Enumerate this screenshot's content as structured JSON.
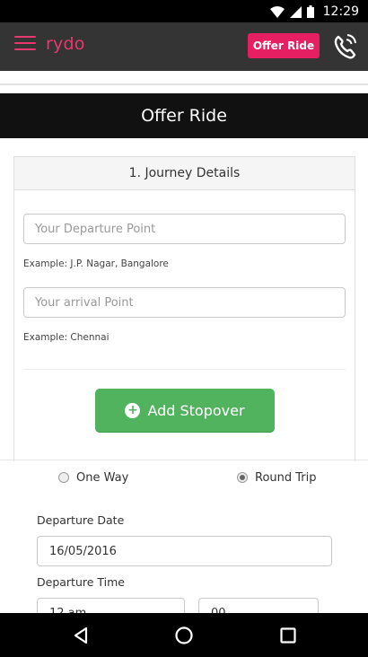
{
  "status_bar": {
    "time": "12:29"
  },
  "app_bar": {
    "logo": "rydo",
    "offer_ride_label": "Offer Ride",
    "accent_color": "#e61f63"
  },
  "page": {
    "title": "Offer Ride"
  },
  "journey": {
    "header": "1. Journey Details",
    "departure_placeholder": "Your Departure Point",
    "departure_example": "Example: J.P. Nagar, Bangalore",
    "arrival_placeholder": "Your arrival Point",
    "arrival_example": "Example: Chennai",
    "add_stopover_label": "Add Stopover",
    "add_stopover_color": "#52b35f"
  },
  "trip_type": {
    "options": [
      {
        "label": "One Way",
        "selected": false
      },
      {
        "label": "Round Trip",
        "selected": true
      }
    ]
  },
  "departure": {
    "date_label": "Departure Date",
    "date_value": "16/05/2016",
    "time_label": "Departure Time",
    "hour_value": "12 am",
    "minute_value": "00"
  },
  "nav": {
    "icons": [
      "back-icon",
      "home-icon",
      "recents-icon"
    ]
  }
}
